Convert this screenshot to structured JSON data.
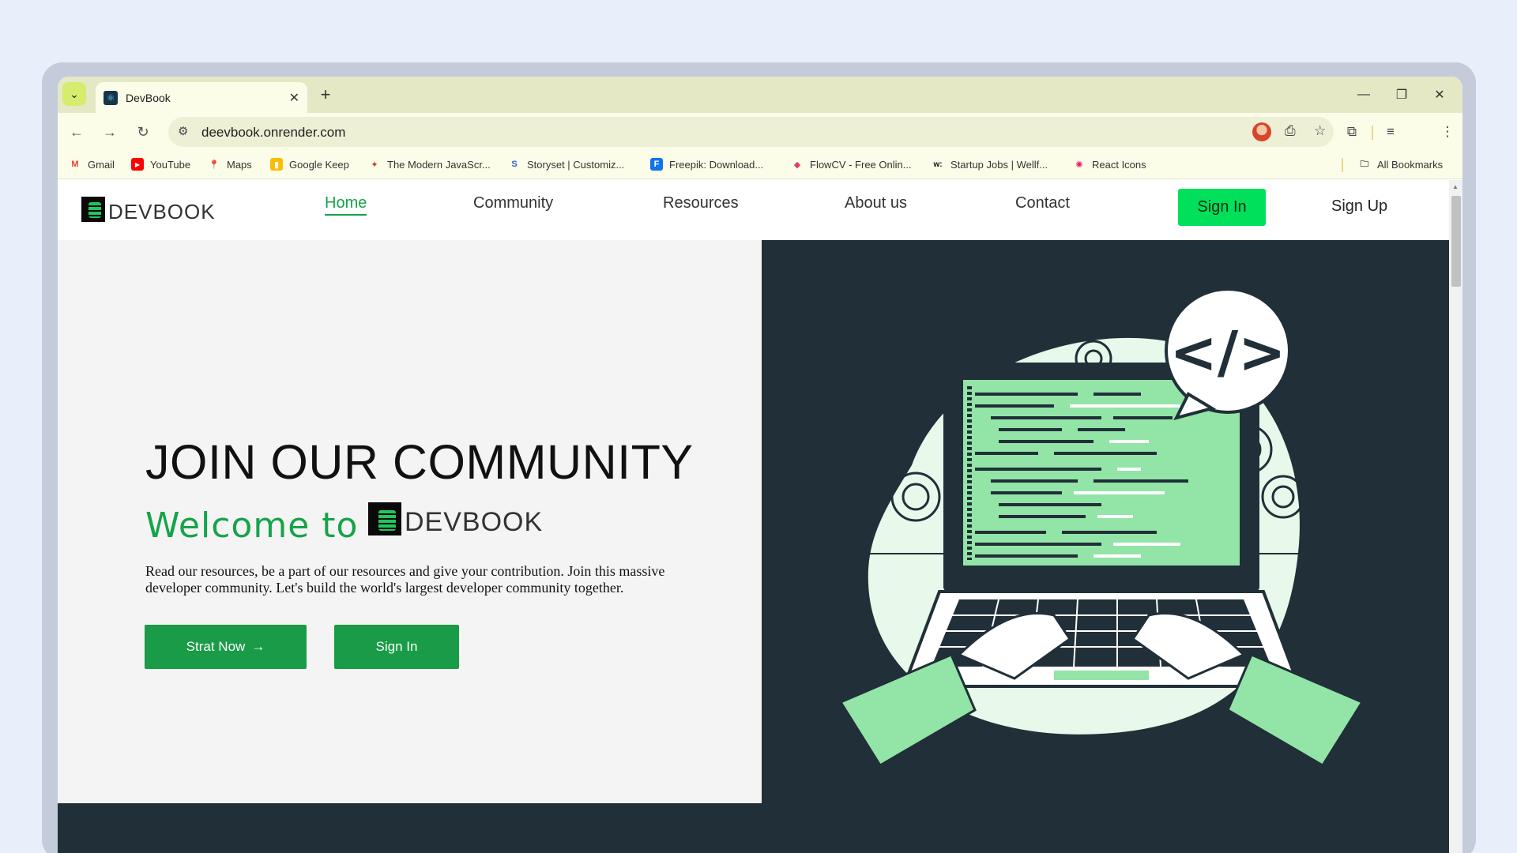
{
  "browser": {
    "tab_title": "DevBook",
    "url": "deevbook.onrender.com",
    "bookmarks": [
      {
        "label": "Gmail",
        "icon": "gmail-icon",
        "color": "#ea4335",
        "glyph": "M"
      },
      {
        "label": "YouTube",
        "icon": "youtube-icon",
        "color": "#ff0000",
        "glyph": "▶"
      },
      {
        "label": "Maps",
        "icon": "maps-icon",
        "color": "#34a853",
        "glyph": "⬤"
      },
      {
        "label": "Google Keep",
        "icon": "keep-icon",
        "color": "#fbbc04",
        "glyph": "▮"
      },
      {
        "label": "The Modern JavaScr...",
        "icon": "javascript-info-icon",
        "color": "#c0392b",
        "glyph": "✦"
      },
      {
        "label": "Storyset | Customiz...",
        "icon": "storyset-icon",
        "color": "#3b5bdb",
        "glyph": "S"
      },
      {
        "label": "Freepik: Download...",
        "icon": "freepik-icon",
        "color": "#1273eb",
        "glyph": "F"
      },
      {
        "label": "FlowCV - Free Onlin...",
        "icon": "flowcv-icon",
        "color": "#e6396b",
        "glyph": "◆"
      },
      {
        "label": "Startup Jobs | Wellf...",
        "icon": "wellfound-icon",
        "color": "#111111",
        "glyph": "w:"
      },
      {
        "label": "React Icons",
        "icon": "react-icons-icon",
        "color": "#e91e63",
        "glyph": "✺"
      }
    ],
    "all_bookmarks": "All Bookmarks"
  },
  "site": {
    "logo_text": "DEVBOOK",
    "nav": [
      "Home",
      "Community",
      "Resources",
      "About us",
      "Contact"
    ],
    "sign_in": "Sign In",
    "sign_up": "Sign Up"
  },
  "hero": {
    "title": "JOIN OUR COMMUNITY",
    "welcome": "Welcome to",
    "logo_text": "DEVBOOK",
    "description": "Read our resources, be a part of our resources and give your contribution. Join this massive developer community. Let's build the world's largest developer community together.",
    "start_button": "Strat Now",
    "signin_button": "Sign In"
  },
  "colors": {
    "accent": "#16a34a",
    "nav_button": "#00e05a",
    "dark_panel": "#212f38",
    "illustration_green": "#93e4a7"
  }
}
